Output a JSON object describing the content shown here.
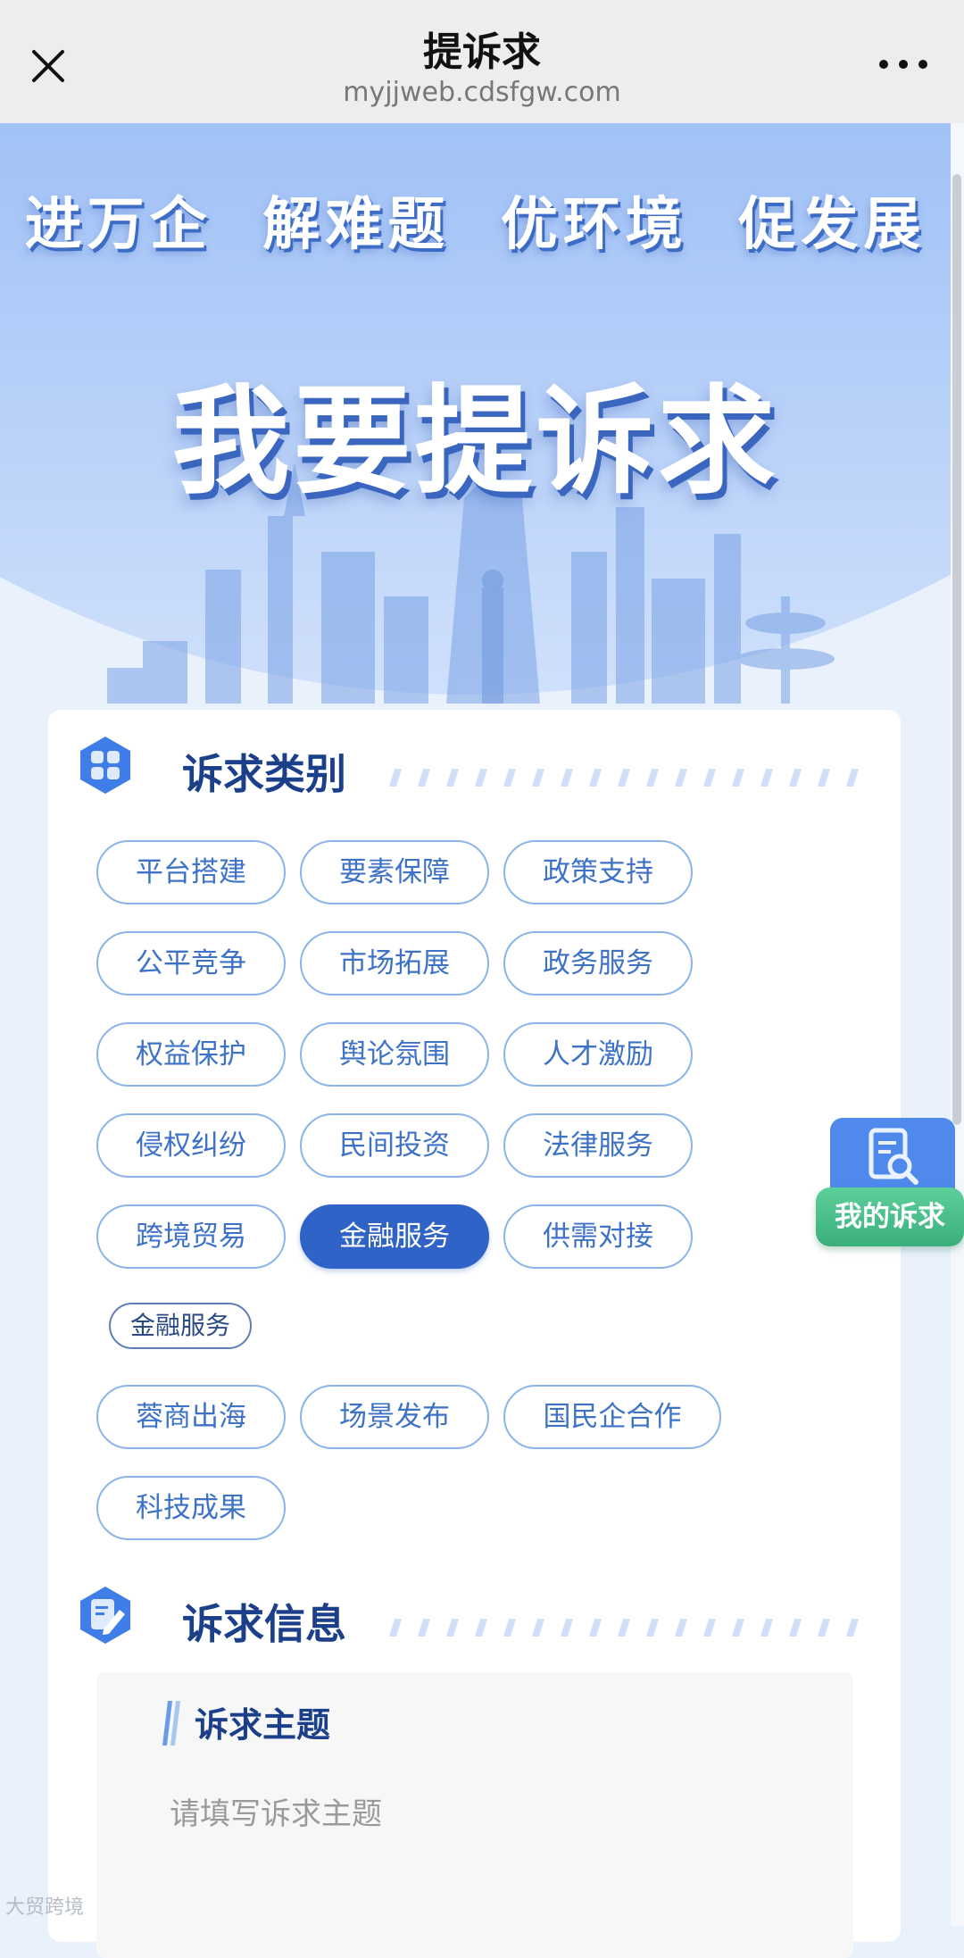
{
  "topbar": {
    "title": "提诉求",
    "url": "myjjweb.cdsfgw.com"
  },
  "hero": {
    "slogan": "进万企  解难题  优环境  促发展",
    "title": "我要提诉求"
  },
  "section_category": {
    "title": "诉求类别",
    "tags": [
      {
        "label": "平台搭建",
        "active": false
      },
      {
        "label": "要素保障",
        "active": false
      },
      {
        "label": "政策支持",
        "active": false
      },
      {
        "label": "公平竞争",
        "active": false
      },
      {
        "label": "市场拓展",
        "active": false
      },
      {
        "label": "政务服务",
        "active": false
      },
      {
        "label": "权益保护",
        "active": false
      },
      {
        "label": "舆论氛围",
        "active": false
      },
      {
        "label": "人才激励",
        "active": false
      },
      {
        "label": "侵权纠纷",
        "active": false
      },
      {
        "label": "民间投资",
        "active": false
      },
      {
        "label": "法律服务",
        "active": false
      },
      {
        "label": "跨境贸易",
        "active": false
      },
      {
        "label": "金融服务",
        "active": true
      },
      {
        "label": "供需对接",
        "active": false
      },
      {
        "label": "蓉商出海",
        "active": false
      },
      {
        "label": "场景发布",
        "active": false
      },
      {
        "label": "国民企合作",
        "active": false
      },
      {
        "label": "科技成果",
        "active": false
      }
    ],
    "subtag": "金融服务"
  },
  "section_info": {
    "title": "诉求信息",
    "field_label": "诉求主题",
    "field_placeholder": "请填写诉求主题"
  },
  "float_button": {
    "label": "我的诉求"
  },
  "watermark": "大贸跨境",
  "colors": {
    "accent": "#2f63c8",
    "tag_border": "#8bb5e9",
    "tag_text": "#3d72c7",
    "float_green": "#3aaf7c",
    "heading": "#1c3f8a"
  }
}
